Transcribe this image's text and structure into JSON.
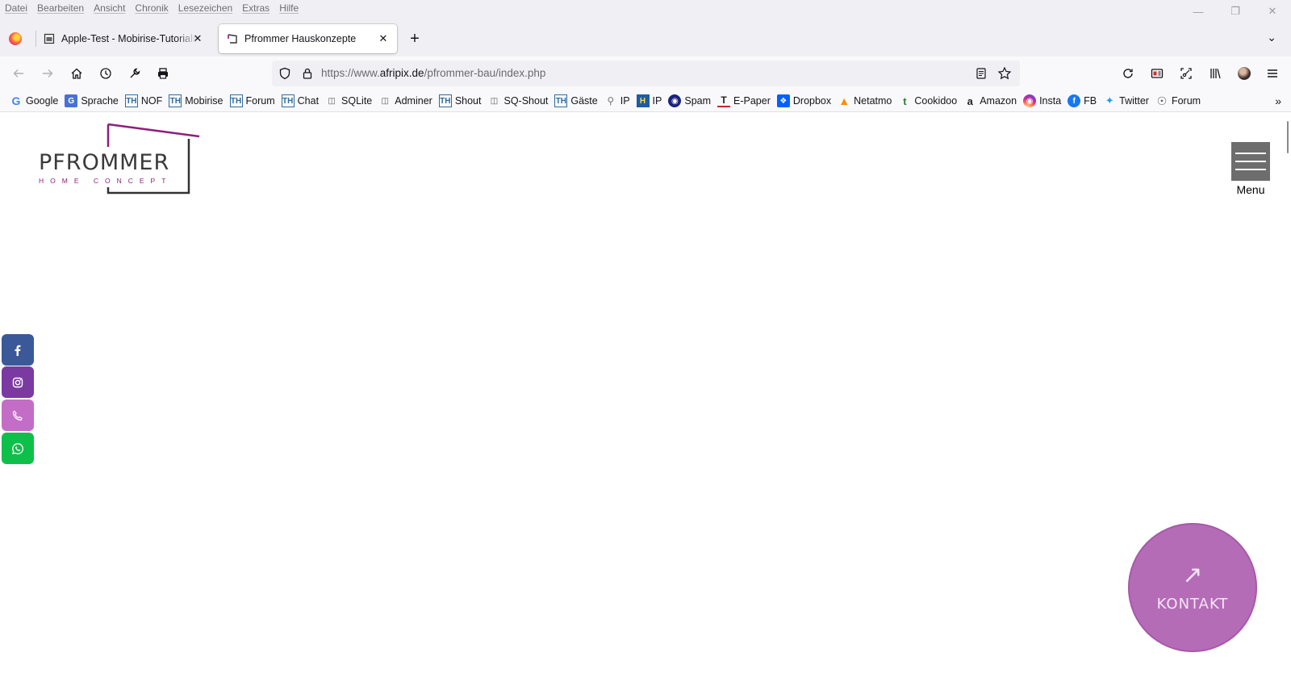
{
  "menubar": {
    "items": [
      "Datei",
      "Bearbeiten",
      "Ansicht",
      "Chronik",
      "Lesezeichen",
      "Extras",
      "Hilfe"
    ]
  },
  "tabs": [
    {
      "title": "Apple-Test - Mobirise-Tutorials",
      "icon": "page-icon",
      "active": false
    },
    {
      "title": "Pfrommer Hauskonzepte",
      "icon": "pfrommer-favicon",
      "active": true
    }
  ],
  "url": {
    "prefix": "https://www.",
    "domain": "afripix.de",
    "path": "/pfrommer-bau/index.php"
  },
  "bookmarks": [
    {
      "label": "Google",
      "icon": "google-icon",
      "color": "#4285f4"
    },
    {
      "label": "Sprache",
      "icon": "translate-icon",
      "color": "#4a6fd8"
    },
    {
      "label": "NOF",
      "icon": "th-icon",
      "color": "#2a6ea6"
    },
    {
      "label": "Mobirise",
      "icon": "th-icon",
      "color": "#2a6ea6"
    },
    {
      "label": "Forum",
      "icon": "th-icon",
      "color": "#2a6ea6"
    },
    {
      "label": "Chat",
      "icon": "th-icon",
      "color": "#2a6ea6"
    },
    {
      "label": "SQLite",
      "icon": "db-icon",
      "color": "#555555"
    },
    {
      "label": "Adminer",
      "icon": "db-icon",
      "color": "#555555"
    },
    {
      "label": "Shout",
      "icon": "th-icon",
      "color": "#2a6ea6"
    },
    {
      "label": "SQ-Shout",
      "icon": "db-icon",
      "color": "#555555"
    },
    {
      "label": "Gäste",
      "icon": "th-icon",
      "color": "#2a6ea6"
    },
    {
      "label": "IP",
      "icon": "magnifier-icon",
      "color": "#777777"
    },
    {
      "label": "IP",
      "icon": "ip-icon",
      "color": "#1e5aa8"
    },
    {
      "label": "Spam",
      "icon": "spam-icon",
      "color": "#1a237e"
    },
    {
      "label": "E-Paper",
      "icon": "epaper-icon",
      "color": "#c62828"
    },
    {
      "label": "Dropbox",
      "icon": "dropbox-icon",
      "color": "#0061fe"
    },
    {
      "label": "Netatmo",
      "icon": "netatmo-icon",
      "color": "#ff8a00"
    },
    {
      "label": "Cookidoo",
      "icon": "cookidoo-icon",
      "color": "#2e7d32"
    },
    {
      "label": "Amazon",
      "icon": "amazon-icon",
      "color": "#222222"
    },
    {
      "label": "Insta",
      "icon": "instagram-icon",
      "color": "#e1306c"
    },
    {
      "label": "FB",
      "icon": "facebook-icon",
      "color": "#1877f2"
    },
    {
      "label": "Twitter",
      "icon": "twitter-icon",
      "color": "#1da1f2"
    },
    {
      "label": "Forum",
      "icon": "globe-icon",
      "color": "#555555"
    }
  ],
  "logo": {
    "title": "PFROMMER",
    "subtitle": "HOME CONCEPT",
    "accent": "#8e1f7c"
  },
  "menu": {
    "label": "Menu"
  },
  "social": [
    {
      "name": "facebook",
      "icon": "facebook-icon",
      "color": "#3b5998"
    },
    {
      "name": "instagram",
      "icon": "instagram-icon",
      "color": "#7a3aa1"
    },
    {
      "name": "phone",
      "icon": "phone-icon",
      "color": "#c46dc7"
    },
    {
      "name": "whatsapp",
      "icon": "whatsapp-icon",
      "color": "#0ec04a"
    }
  ],
  "contact": {
    "label": "KONTAKT",
    "icon": "arrow-up-right-icon",
    "color": "#b56cb7"
  }
}
